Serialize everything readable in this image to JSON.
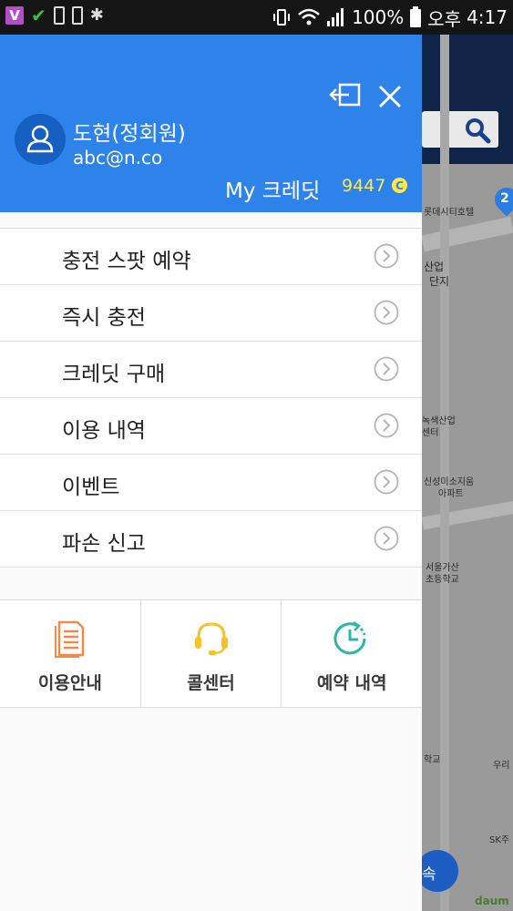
{
  "status_bar": {
    "battery_percent": "100%",
    "ampm": "오후",
    "time": "4:17",
    "app_badge": "V"
  },
  "drawer": {
    "user": {
      "name": "도현(정회원)",
      "email": "abc@n.co"
    },
    "credit": {
      "label": "My 크레딧",
      "value": "9447",
      "coin_symbol": "C"
    },
    "menu": [
      {
        "label": "충전 스팟 예약"
      },
      {
        "label": "즉시 충전"
      },
      {
        "label": "크레딧 구매"
      },
      {
        "label": "이용 내역"
      },
      {
        "label": "이벤트"
      },
      {
        "label": "파손 신고"
      }
    ],
    "quick_actions": [
      {
        "label": "이용안내",
        "icon": "document-icon",
        "color": "#f08a4b"
      },
      {
        "label": "콜센터",
        "icon": "headset-icon",
        "color": "#f6c22c"
      },
      {
        "label": "예약 내역",
        "icon": "clock-icon",
        "color": "#2bb6a8"
      }
    ]
  },
  "map": {
    "labels": [
      "롯데시티호텔",
      "산업",
      "단지",
      "녹색산업",
      "센터",
      "신성미소지움",
      "아파트",
      "서울가산",
      "초등학교",
      "학교",
      "우리",
      "SK주"
    ],
    "pin_badge": "2",
    "fab_label": "속",
    "watermark": "daum"
  },
  "colors": {
    "header_blue": "#2e83ea",
    "credit_yellow": "#ffe84a"
  }
}
